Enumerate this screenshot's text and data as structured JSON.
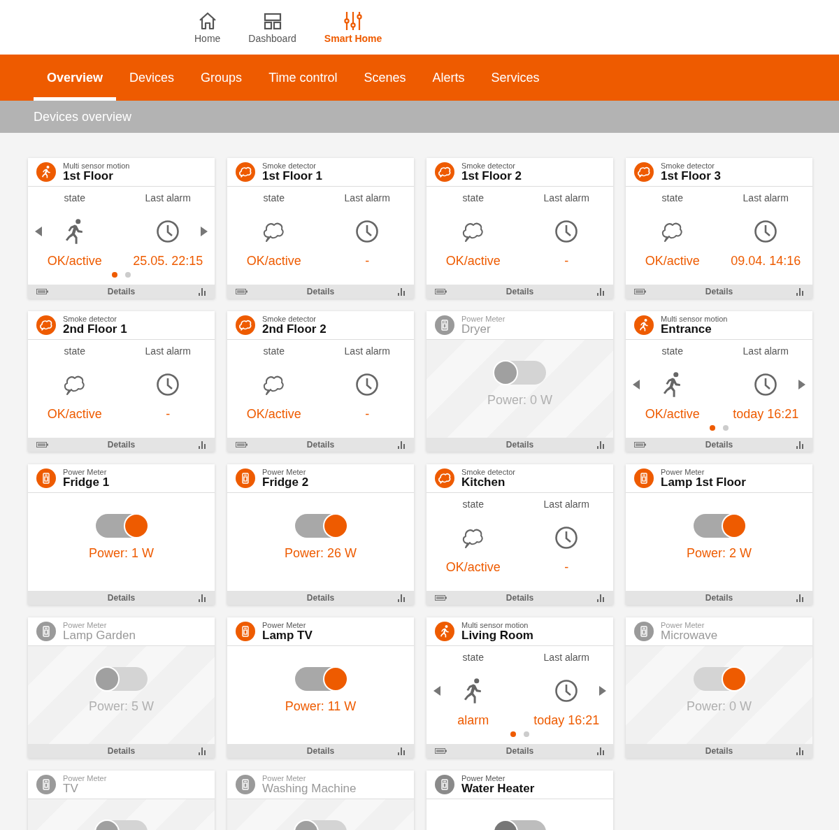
{
  "top_nav": [
    {
      "label": "Home",
      "kind": "home",
      "selected": false
    },
    {
      "label": "Dashboard",
      "kind": "dashboard",
      "selected": false
    },
    {
      "label": "Smart Home",
      "kind": "sliders",
      "selected": true
    }
  ],
  "tabs": [
    {
      "label": "Overview",
      "selected": true
    },
    {
      "label": "Devices",
      "selected": false
    },
    {
      "label": "Groups",
      "selected": false
    },
    {
      "label": "Time control",
      "selected": false
    },
    {
      "label": "Scenes",
      "selected": false
    },
    {
      "label": "Alerts",
      "selected": false
    },
    {
      "label": "Services",
      "selected": false
    }
  ],
  "section_title": "Devices overview",
  "cards": [
    {
      "kind": "motion",
      "type": "Multi sensor motion",
      "name": "1st Floor",
      "state_label": "state",
      "alarm_label": "Last alarm",
      "state": "OK/active",
      "last_alarm": "25.05. 22:15",
      "pages": [
        {
          "selected": true
        },
        {
          "selected": false
        }
      ],
      "details": "Details"
    },
    {
      "kind": "smoke",
      "type": "Smoke detector",
      "name": "1st Floor 1",
      "state_label": "state",
      "alarm_label": "Last alarm",
      "state": "OK/active",
      "last_alarm": "-",
      "details": "Details"
    },
    {
      "kind": "smoke",
      "type": "Smoke detector",
      "name": "1st Floor 2",
      "state_label": "state",
      "alarm_label": "Last alarm",
      "state": "OK/active",
      "last_alarm": "-",
      "details": "Details"
    },
    {
      "kind": "smoke",
      "type": "Smoke detector",
      "name": "1st Floor 3",
      "state_label": "state",
      "alarm_label": "Last alarm",
      "state": "OK/active",
      "last_alarm": "09.04. 14:16",
      "details": "Details"
    },
    {
      "kind": "smoke",
      "type": "Smoke detector",
      "name": "2nd Floor 1",
      "state_label": "state",
      "alarm_label": "Last alarm",
      "state": "OK/active",
      "last_alarm": "-",
      "details": "Details"
    },
    {
      "kind": "smoke",
      "type": "Smoke detector",
      "name": "2nd Floor 2",
      "state_label": "state",
      "alarm_label": "Last alarm",
      "state": "OK/active",
      "last_alarm": "-",
      "details": "Details"
    },
    {
      "kind": "power",
      "type": "Power Meter",
      "name": "Dryer",
      "disabled": true,
      "on": false,
      "power": "Power: 0 W",
      "details": "Details"
    },
    {
      "kind": "motion",
      "type": "Multi sensor motion",
      "name": "Entrance",
      "state_label": "state",
      "alarm_label": "Last alarm",
      "state": "OK/active",
      "last_alarm": "today 16:21",
      "pages": [
        {
          "selected": true
        },
        {
          "selected": false
        }
      ],
      "details": "Details"
    },
    {
      "kind": "power",
      "type": "Power Meter",
      "name": "Fridge 1",
      "disabled": false,
      "on": true,
      "power": "Power: 1 W",
      "details": "Details"
    },
    {
      "kind": "power",
      "type": "Power Meter",
      "name": "Fridge 2",
      "disabled": false,
      "on": true,
      "power": "Power: 26 W",
      "details": "Details"
    },
    {
      "kind": "smoke",
      "type": "Smoke detector",
      "name": "Kitchen",
      "state_label": "state",
      "alarm_label": "Last alarm",
      "state": "OK/active",
      "last_alarm": "-",
      "details": "Details"
    },
    {
      "kind": "power",
      "type": "Power Meter",
      "name": "Lamp 1st Floor",
      "disabled": false,
      "on": true,
      "power": "Power: 2 W",
      "details": "Details"
    },
    {
      "kind": "power",
      "type": "Power Meter",
      "name": "Lamp Garden",
      "disabled": true,
      "on": false,
      "power": "Power: 5 W",
      "details": "Details"
    },
    {
      "kind": "power",
      "type": "Power Meter",
      "name": "Lamp TV",
      "disabled": false,
      "on": true,
      "power": "Power: 11 W",
      "details": "Details"
    },
    {
      "kind": "motion",
      "type": "Multi sensor motion",
      "name": "Living Room",
      "state_label": "state",
      "alarm_label": "Last alarm",
      "state": "alarm",
      "last_alarm": "today 16:21",
      "pages": [
        {
          "selected": true
        },
        {
          "selected": false
        }
      ],
      "details": "Details"
    },
    {
      "kind": "power",
      "type": "Power Meter",
      "name": "Microwave",
      "disabled": true,
      "on": true,
      "power": "Power: 0 W",
      "details": "Details"
    },
    {
      "kind": "power",
      "type": "Power Meter",
      "name": "TV",
      "disabled": true,
      "on": false
    },
    {
      "kind": "power",
      "type": "Power Meter",
      "name": "Washing Machine",
      "disabled": true,
      "on": false
    },
    {
      "kind": "power",
      "type": "Power Meter",
      "name": "Water Heater",
      "disabled": false,
      "on": false
    }
  ]
}
